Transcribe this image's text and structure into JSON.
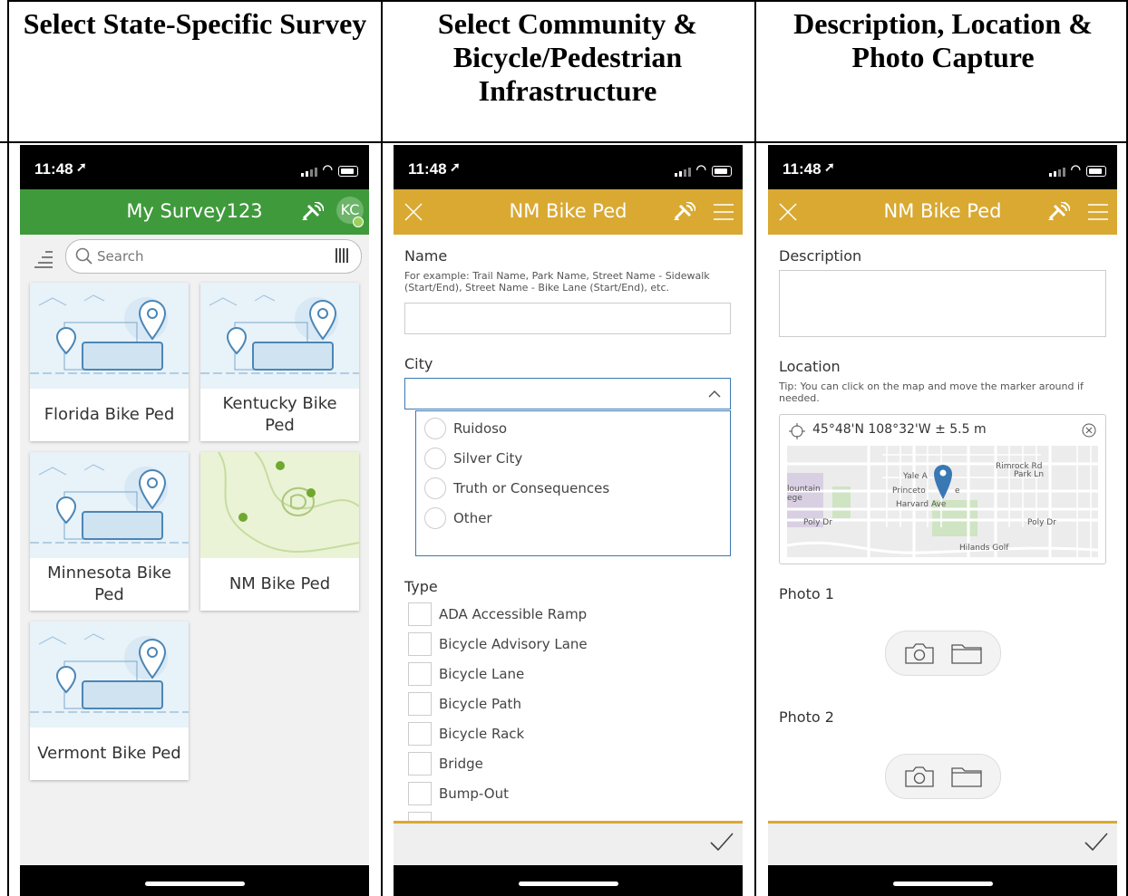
{
  "headings": {
    "col1": "Select State-Specific Survey",
    "col2": "Select Community & Bicycle/Pedestrian Infrastructure",
    "col3": "Description, Location & Photo Capture"
  },
  "colors": {
    "survey_green": "#3f9a3b",
    "form_gold": "#d9a932",
    "accent_blue": "#3a78b4"
  },
  "phone1": {
    "time": "11:48",
    "app_title": "My Survey123",
    "avatar": "KC",
    "search_placeholder": "Search",
    "cards": [
      {
        "label": "Florida Bike Ped",
        "thumb": "city-illustration"
      },
      {
        "label": "Kentucky Bike Ped",
        "thumb": "city-illustration"
      },
      {
        "label": "Minnesota Bike Ped",
        "thumb": "city-illustration"
      },
      {
        "label": "NM Bike Ped",
        "thumb": "topo-map"
      },
      {
        "label": "Vermont Bike Ped",
        "thumb": "city-illustration"
      }
    ]
  },
  "phone2": {
    "time": "11:48",
    "title": "NM Bike Ped",
    "name_label": "Name",
    "name_hint": "For example: Trail Name, Park Name, Street Name - Sidewalk (Start/End), Street Name - Bike Lane (Start/End), etc.",
    "city_label": "City",
    "city_options": [
      "Ruidoso",
      "Silver City",
      "Truth or Consequences",
      "Other"
    ],
    "type_label": "Type",
    "type_options": [
      "ADA Accessible Ramp",
      "Bicycle Advisory Lane",
      "Bicycle Lane",
      "Bicycle Path",
      "Bicycle Rack",
      "Bridge",
      "Bump-Out"
    ]
  },
  "phone3": {
    "time": "11:48",
    "title": "NM Bike Ped",
    "description_label": "Description",
    "location_label": "Location",
    "location_hint": "Tip: You can click on the map and move the marker around if needed.",
    "coordinates": "45°48'N 108°32'W ± 5.5 m",
    "map_labels": [
      "Rimrock Rd",
      "Park Ln",
      "Yale A",
      "lountain",
      "ege",
      "Princeto",
      "e",
      "Harvard Ave",
      "Poly Dr",
      "Poly Dr",
      "Hilands Golf"
    ],
    "photo1_label": "Photo 1",
    "photo2_label": "Photo 2"
  }
}
